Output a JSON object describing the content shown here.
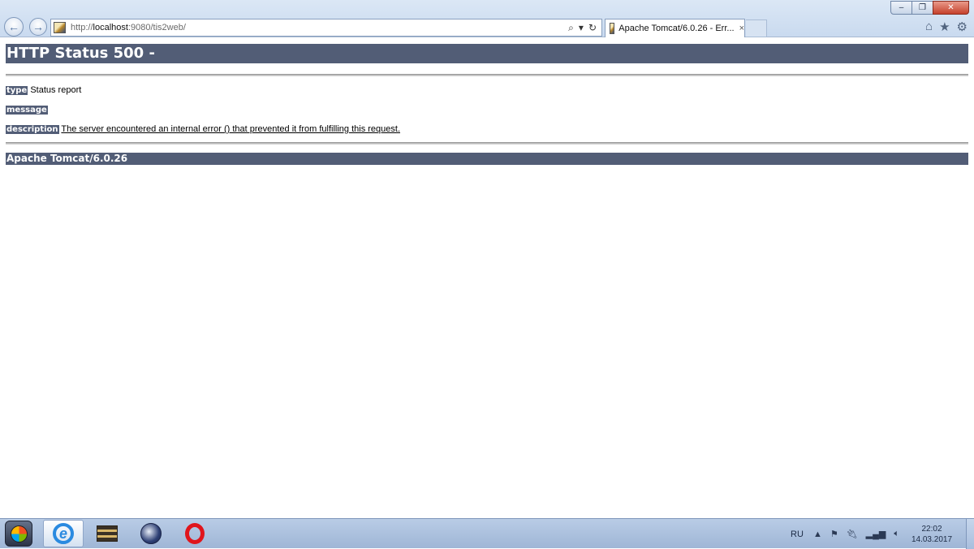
{
  "browser": {
    "address": {
      "prefix": "http://",
      "host": "localhost",
      "rest": ":9080/tis2web/"
    },
    "tab": {
      "title": "Apache Tomcat/6.0.26 - Err...",
      "close": "×"
    },
    "window_controls": {
      "minimize": "–",
      "restore": "❐",
      "close": "✕"
    },
    "address_tools": {
      "search": "⌕",
      "dropdown": "▾",
      "refresh": "↻"
    },
    "toolbar": {
      "home": "⌂",
      "favorites": "★",
      "settings": "⚙"
    },
    "nav": {
      "back": "←",
      "forward": "→"
    }
  },
  "page": {
    "heading": "HTTP Status 500 -",
    "type_label": "type",
    "type_value": "Status report",
    "message_label": "message",
    "message_value": "",
    "description_label": "description",
    "description_value": "The server encountered an internal error () that prevented it from fulfilling this request.",
    "footer": "Apache Tomcat/6.0.26"
  },
  "taskbar": {
    "tray": {
      "language": "RU",
      "show_hidden": "▲",
      "time": "22:02",
      "date": "14.03.2017"
    }
  },
  "colors": {
    "heading_bg": "#525d76",
    "heading_fg": "#ffffff"
  }
}
